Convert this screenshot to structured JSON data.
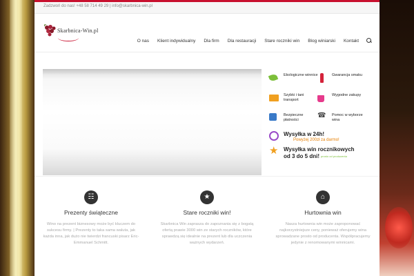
{
  "topbar": {
    "text": "Zadzwoń do nas! +48 58 714 49 29 | info@skarbnica-win.pl"
  },
  "header": {
    "logo_text": "Skarbnica-Win.pl",
    "nav": [
      "O nas",
      "Klient indywidualny",
      "Dla firm",
      "Dla restauracji",
      "Stare roczniki win",
      "Blog winiarski",
      "Kontakt"
    ],
    "search_icon": "search-icon"
  },
  "features": [
    {
      "icon": "leaf-icon",
      "label": "Ekologiczne winnice",
      "color": "#7cbf3a"
    },
    {
      "icon": "bottle-icon",
      "label": "Gwarancja smaku",
      "color": "#d4223a"
    },
    {
      "icon": "box-icon",
      "label": "Szybki i tani transport",
      "color": "#f0a020"
    },
    {
      "icon": "bag-icon",
      "label": "Wygodne zakupy",
      "color": "#e63b8c"
    },
    {
      "icon": "safe-icon",
      "label": "Bezpieczne płatności",
      "color": "#3a7ac8"
    },
    {
      "icon": "phone-icon",
      "label": "Pomoc w wyborze wina",
      "color": "#444444"
    }
  ],
  "shipping": {
    "line1_title": "Wysyłka w 24h!",
    "line1_sub": "Powyżej 200zł za darmo!",
    "line2_title": "Wysyłka win rocznikowych",
    "line2_detail": "od 3 do 5 dni!",
    "line2_note": "prosto od producenta"
  },
  "columns": [
    {
      "icon": "gift-icon",
      "title": "Prezenty świąteczne",
      "text": "Wino na prezent biznesowy może być kluczem do sukcesu firmy. | Prezenty to taka sama waluta, jak każda inna, jak dużo nie twierdzi francuski pisarz Eric-Emmanuel Schmitt."
    },
    {
      "icon": "star-icon",
      "title": "Stare roczniki win!",
      "text": "Skarbnica Win zaprasza do zapoznania się z bogatą ofertą prawie 3000 win ze starych roczników, które sprawdzą się idealnie na prezent lub dla uczczenia ważnych wydarzeń."
    },
    {
      "icon": "warehouse-icon",
      "title": "Hurtownia win",
      "text": "Nasza hurtownia win może zaproponować najkorzystniejsze ceny, ponieważ oferujemy wina sprowadzane prosto od producenta. Współpracujemy jedynie z renomowanymi winnicami."
    }
  ]
}
